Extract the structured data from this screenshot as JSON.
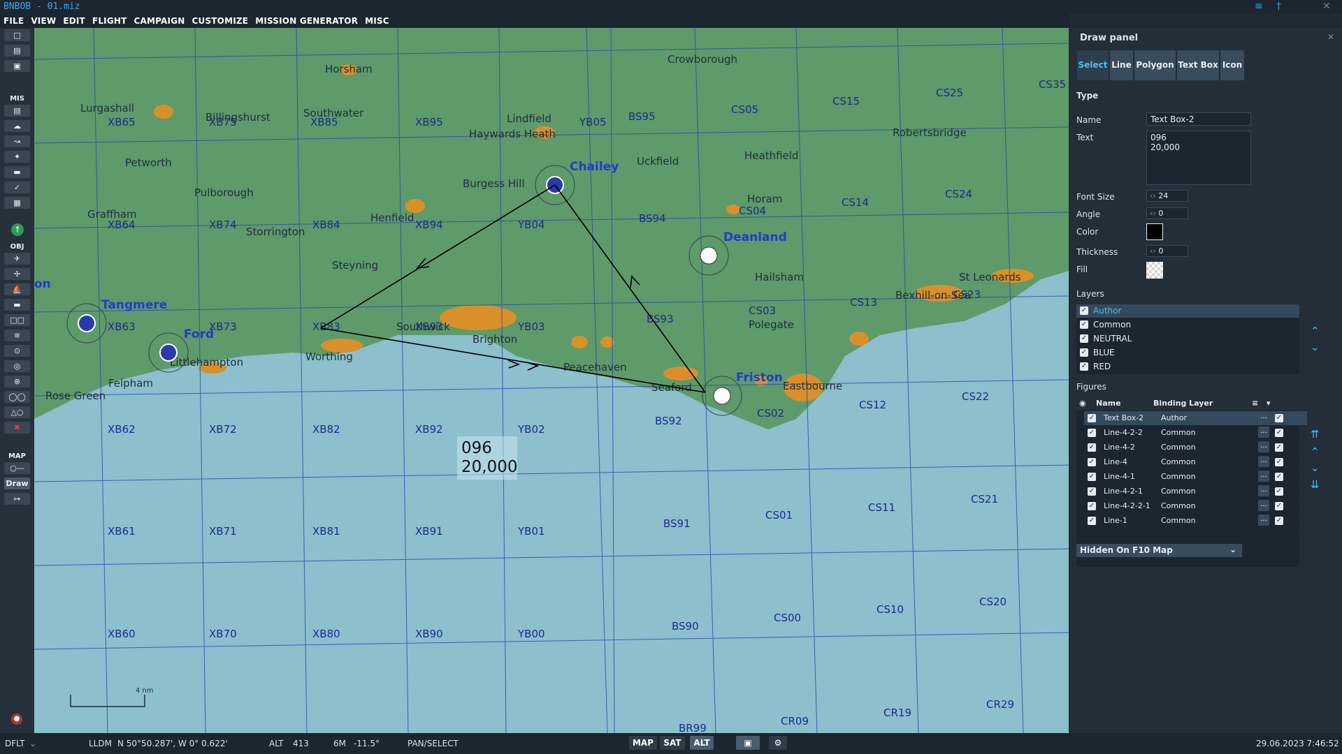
{
  "window": {
    "title": "BNBOB - 01.miz"
  },
  "menu": [
    "FILE",
    "VIEW",
    "EDIT",
    "FLIGHT",
    "CAMPAIGN",
    "CUSTOMIZE",
    "MISSION GENERATOR",
    "MISC"
  ],
  "toolbar": {
    "mis_label": "MIS",
    "obj_label": "OBJ",
    "map_label": "MAP",
    "draw_label": "Draw"
  },
  "map": {
    "grid_labels": [
      "XB65",
      "XB75",
      "XB85",
      "XB95",
      "YB05",
      "BS95",
      "CS05",
      "CS15",
      "CS25",
      "CS35",
      "XB64",
      "XB74",
      "XB84",
      "XB94",
      "YB04",
      "BS94",
      "CS04",
      "CS14",
      "CS24",
      "XB63",
      "XB73",
      "XB83",
      "XB93",
      "YB03",
      "BS93",
      "CS03",
      "CS13",
      "CS23",
      "XB62",
      "XB72",
      "XB82",
      "XB92",
      "YB02",
      "BS92",
      "CS02",
      "CS12",
      "CS22",
      "XB61",
      "XB71",
      "XB81",
      "XB91",
      "YB01",
      "BS91",
      "CS01",
      "CS11",
      "CS21",
      "XB60",
      "XB70",
      "XB80",
      "XB90",
      "YB00",
      "BS90",
      "CS00",
      "CS10",
      "CS20",
      "CR09",
      "CR19",
      "CR29",
      "BR99"
    ],
    "towns": [
      "Horsham",
      "Crowborough",
      "Lurgashall",
      "Billingshurst",
      "Southwater",
      "Lindfield",
      "Haywards Heath",
      "Petworth",
      "Uckfield",
      "Heathfield",
      "Robertsbridge",
      "Burgess Hill",
      "Graffham",
      "Pulborough",
      "Henfield",
      "Horam",
      "Storrington",
      "Steyning",
      "Hailsham",
      "Polegate",
      "Bexhill-on-Sea",
      "St Leonards",
      "Worthing",
      "Southwick",
      "Brighton",
      "Peacehaven",
      "Seaford",
      "Eastbourne",
      "Littlehampton",
      "Felpham",
      "Rose Green"
    ],
    "airbases": [
      "Tangmere",
      "Ford",
      "Chailey",
      "Deanland",
      "Friston"
    ],
    "text_box": {
      "line1": "096",
      "line2": "20,000"
    },
    "scale_label": "4 nm",
    "edge_label": "on"
  },
  "panel": {
    "title": "Draw panel",
    "tabs": [
      "Select",
      "Line",
      "Polygon",
      "Text Box",
      "Icon"
    ],
    "type_label": "Type",
    "name_label": "Name",
    "name_value": "Text Box-2",
    "text_label": "Text",
    "text_value": "096\n20,000",
    "font_size_label": "Font Size",
    "font_size_value": "24",
    "angle_label": "Angle",
    "angle_value": "0",
    "color_label": "Color",
    "color_value": "#000000",
    "thickness_label": "Thickness",
    "thickness_value": "0",
    "fill_label": "Fill",
    "layers_label": "Layers",
    "layers": [
      "Author",
      "Common",
      "NEUTRAL",
      "BLUE",
      "RED"
    ],
    "figures_label": "Figures",
    "figures_headers": [
      "Name",
      "Binding Layer"
    ],
    "figures": [
      {
        "name": "Text Box-2",
        "layer": "Author"
      },
      {
        "name": "Line-4-2-2",
        "layer": "Common"
      },
      {
        "name": "Line-4-2",
        "layer": "Common"
      },
      {
        "name": "Line-4",
        "layer": "Common"
      },
      {
        "name": "Line-4-1",
        "layer": "Common"
      },
      {
        "name": "Line-4-2-1",
        "layer": "Common"
      },
      {
        "name": "Line-4-2-2-1",
        "layer": "Common"
      },
      {
        "name": "Line-1",
        "layer": "Common"
      }
    ],
    "dots": "...",
    "visibility_dropdown": "Hidden On F10 Map"
  },
  "status": {
    "profile": "DFLT",
    "coord_mode": "LLDM",
    "coords": "N 50°50.287', W  0° 0.622'",
    "alt_label": "ALT",
    "alt_value": "413",
    "mag_label": "6M",
    "mag_value": "-11.5°",
    "mode": "PAN/SELECT",
    "map_btn": "MAP",
    "sat_btn": "SAT",
    "alt_btn": "ALT",
    "datetime": "29.06.2023 7:46:52"
  },
  "colors": {
    "accent": "#2f9ee8",
    "sea": "#8dbfcd",
    "land": "#5e9a6a",
    "urban": "#d9902a",
    "grid": "#1d2a8a",
    "airbase_label": "#1e3ccf"
  }
}
